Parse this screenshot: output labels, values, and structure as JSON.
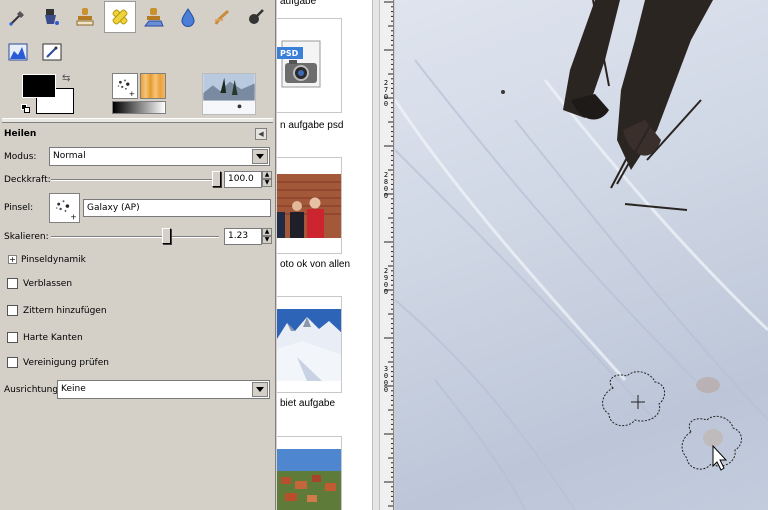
{
  "toolbox": {
    "tools_row1": [
      {
        "name": "color-picker-icon"
      },
      {
        "name": "bucket-fill-icon"
      },
      {
        "name": "clone-stamp-icon"
      },
      {
        "name": "heal-icon",
        "active": true
      },
      {
        "name": "perspective-clone-icon"
      },
      {
        "name": "blur-icon"
      },
      {
        "name": "smudge-icon"
      },
      {
        "name": "dodge-burn-icon"
      }
    ],
    "tools_row2": [
      {
        "name": "levels-icon"
      },
      {
        "name": "pencil-edit-icon"
      }
    ],
    "colors": {
      "foreground": "#000000",
      "background": "#ffffff"
    }
  },
  "tool_options": {
    "title": "Heilen",
    "mode_label": "Modus:",
    "mode_value": "Normal",
    "opacity_label": "Deckkraft:",
    "opacity_value": "100.0",
    "opacity_fraction": 1.0,
    "brush_label": "Pinsel:",
    "brush_value": "Galaxy (AP)",
    "scale_label": "Skalieren:",
    "scale_value": "1.23",
    "brush_dynamics_label": "Pinseldynamik",
    "checkboxes": [
      {
        "label": "Verblassen",
        "checked": false
      },
      {
        "label": "Zittern hinzufügen",
        "checked": false
      },
      {
        "label": "Harte Kanten",
        "checked": false
      },
      {
        "label": "Vereinigung prüfen",
        "checked": false
      }
    ],
    "alignment_label": "Ausrichtung:",
    "alignment_value": "Keine"
  },
  "browser": {
    "items": [
      {
        "caption": "aufgabe",
        "kind": "cut-top"
      },
      {
        "caption": "n aufgabe psd",
        "kind": "psd",
        "badge": "PSD"
      },
      {
        "caption": "oto ok von allen",
        "kind": "photo-people"
      },
      {
        "caption": "biet aufgabe",
        "kind": "photo-mountain"
      },
      {
        "caption": "",
        "kind": "photo-village"
      }
    ]
  },
  "ruler": {
    "labels": [
      {
        "text": [
          "2",
          "7",
          "0",
          "0"
        ],
        "group": "a"
      },
      {
        "text": [
          "2",
          "8",
          "0",
          "0"
        ],
        "group": "b"
      },
      {
        "text": [
          "2",
          "9",
          "0",
          "0"
        ],
        "group": "c"
      },
      {
        "text": [
          "3",
          "0",
          "0",
          "0"
        ],
        "group": "d"
      }
    ]
  }
}
